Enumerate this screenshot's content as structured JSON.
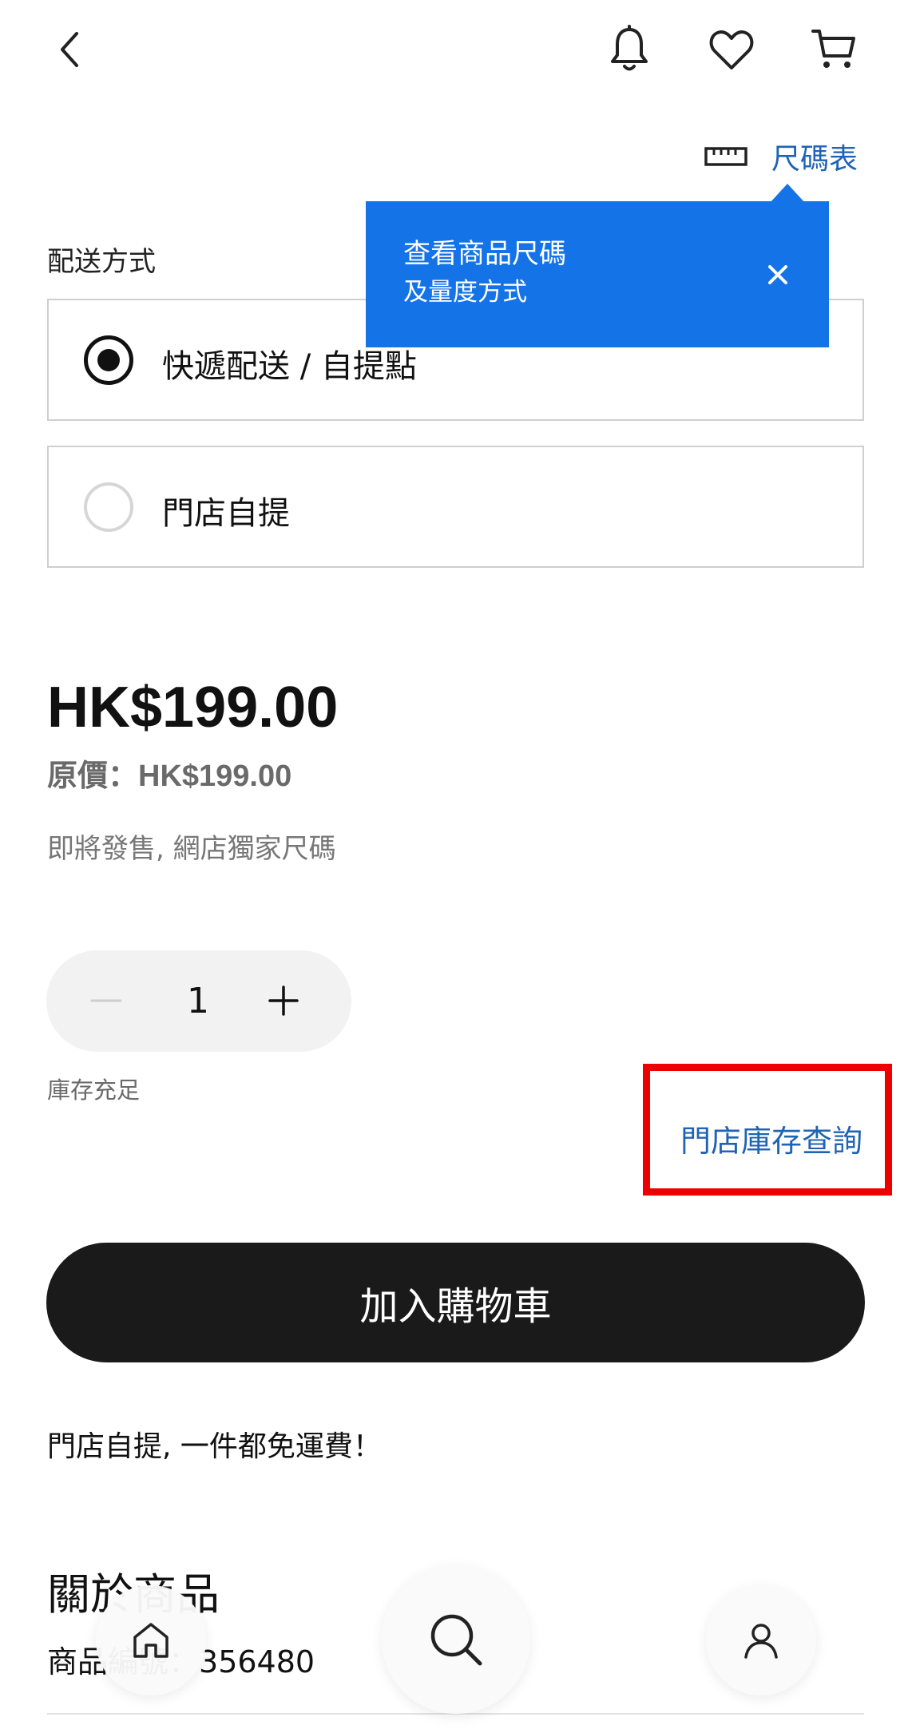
{
  "header": {
    "back_icon": "chevron-left-icon",
    "bell_icon": "bell-icon",
    "wishlist_icon": "heart-icon",
    "cart_icon": "cart-icon"
  },
  "size_chart": {
    "icon": "ruler-icon",
    "label": "尺碼表"
  },
  "tooltip": {
    "line1": "查看商品尺碼",
    "line2": "及量度方式",
    "close_icon": "close-icon"
  },
  "delivery": {
    "label": "配送方式",
    "options": [
      {
        "label": "快遞配送 / 自提點",
        "selected": true
      },
      {
        "label": "門店自提",
        "selected": false
      }
    ]
  },
  "price": {
    "current": "HK$199.00",
    "original": "原價：HK$199.00",
    "note": "即將發售,  網店獨家尺碼"
  },
  "quantity": {
    "value": "1",
    "stock_status": "庫存充足"
  },
  "store_stock_link": "門店庫存查詢",
  "add_to_cart_label": "加入購物車",
  "promo": "門店自提,  一件都免運費！",
  "about": {
    "title": "關於商品",
    "code_label": "商品編號：",
    "code_value": "356480"
  },
  "bottom_nav": {
    "home_icon": "home-icon",
    "search_icon": "search-icon",
    "account_icon": "user-icon"
  },
  "colors": {
    "accent_blue": "#1473e6",
    "link_blue": "#1f63b5",
    "highlight_red": "#ee0000",
    "button_dark": "#1a1a1a"
  }
}
